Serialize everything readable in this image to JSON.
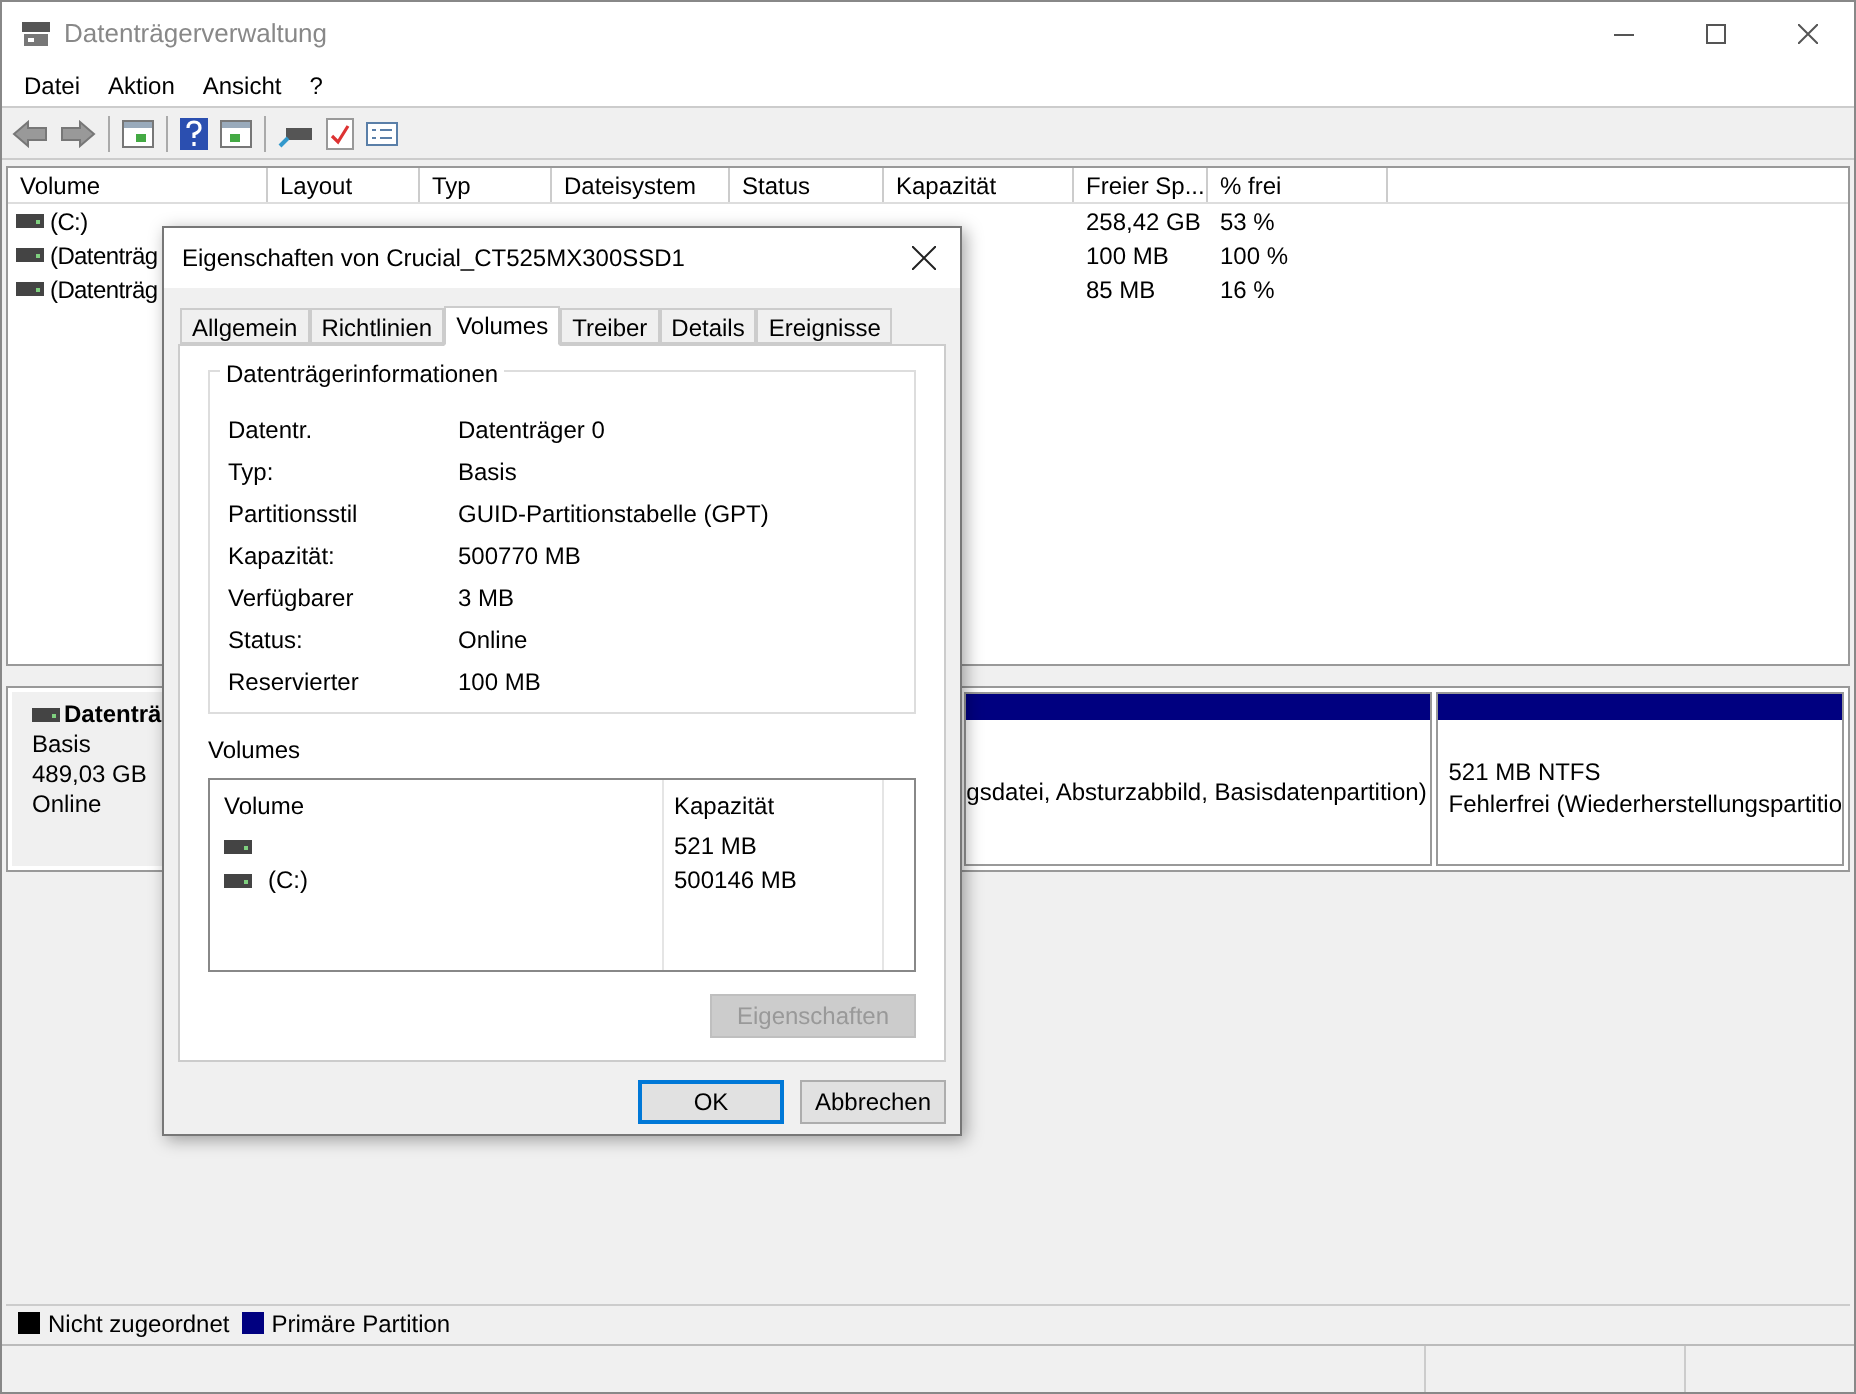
{
  "window": {
    "title": "Datenträgerverwaltung"
  },
  "menu": [
    "Datei",
    "Aktion",
    "Ansicht",
    "?"
  ],
  "table": {
    "columns": [
      "Volume",
      "Layout",
      "Typ",
      "Dateisystem",
      "Status",
      "Kapazität",
      "Freier Sp...",
      "% frei"
    ],
    "rows": [
      {
        "volume": "(C:)",
        "free": "258,42 GB",
        "percent_free": "53 %"
      },
      {
        "volume": "(Datenträg",
        "free": "100 MB",
        "percent_free": "100 %"
      },
      {
        "volume": "(Datenträg",
        "free": "85 MB",
        "percent_free": "16 %"
      }
    ]
  },
  "disk": {
    "name": "Datenträ",
    "type": "Basis",
    "size": "489,03 GB",
    "state": "Online",
    "partitions": [
      {
        "lines": [
          "gsdatei, Absturzabbild, Basisdatenpartition)"
        ]
      },
      {
        "lines": [
          "521 MB NTFS",
          "Fehlerfrei (Wiederherstellungspartitio"
        ]
      }
    ]
  },
  "legend": [
    {
      "label": "Nicht zugeordnet",
      "color": "#000000"
    },
    {
      "label": "Primäre Partition",
      "color": "#000080"
    }
  ],
  "dialog": {
    "title": "Eigenschaften von Crucial_CT525MX300SSD1",
    "tabs": [
      {
        "label": "Allgemein",
        "selected": false
      },
      {
        "label": "Richtlinien",
        "selected": false
      },
      {
        "label": "Volumes",
        "selected": true
      },
      {
        "label": "Treiber",
        "selected": false
      },
      {
        "label": "Details",
        "selected": false
      },
      {
        "label": "Ereignisse",
        "selected": false
      }
    ],
    "info_group": "Datenträgerinformationen",
    "info": [
      [
        "Datentr.",
        "Datenträger 0"
      ],
      [
        "Typ:",
        "Basis"
      ],
      [
        "Partitionsstil",
        "GUID-Partitionstabelle (GPT)"
      ],
      [
        "Kapazität:",
        "500770 MB"
      ],
      [
        "Verfügbarer",
        "3 MB"
      ],
      [
        "Status:",
        "Online"
      ],
      [
        "Reservierter",
        "100 MB"
      ]
    ],
    "volumes_label": "Volumes",
    "volumes_columns": [
      "Volume",
      "Kapazität"
    ],
    "volumes": [
      {
        "capacity": "521 MB"
      },
      {
        "name": "(C:)",
        "capacity": "500146 MB"
      }
    ],
    "properties_button": {
      "label": "Eigenschaften",
      "disabled": true
    },
    "buttons": [
      {
        "label": "OK",
        "selected": true
      },
      {
        "label": "Abbrechen",
        "selected": false
      }
    ]
  }
}
